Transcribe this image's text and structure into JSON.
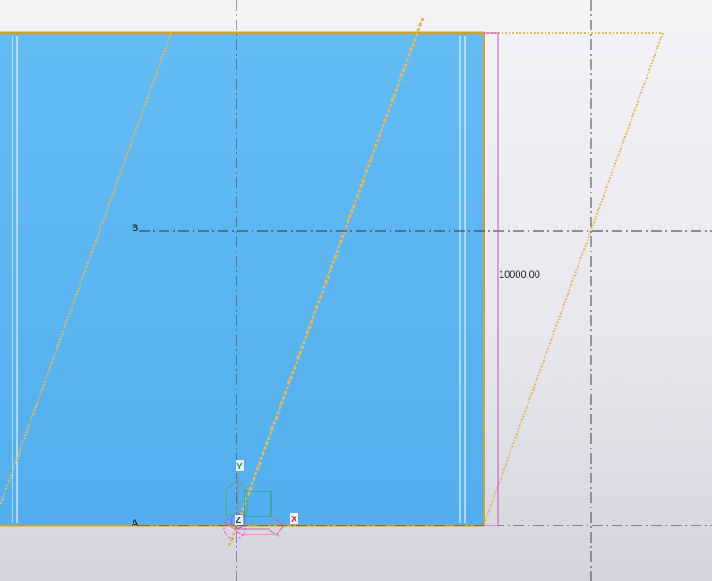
{
  "view": {
    "grid_labels": {
      "b": "B",
      "a": "A"
    },
    "dimension": {
      "value": "10000.00",
      "color": "#d050c8"
    },
    "axis_labels": {
      "y": "Y",
      "z": "Z",
      "x": "X"
    },
    "colors": {
      "slab_fill": "#5ab4f0",
      "slab_edge": "#c9a23a",
      "rebar": "#e2b860",
      "gridline": "#333333",
      "background": "#ececf1"
    }
  }
}
